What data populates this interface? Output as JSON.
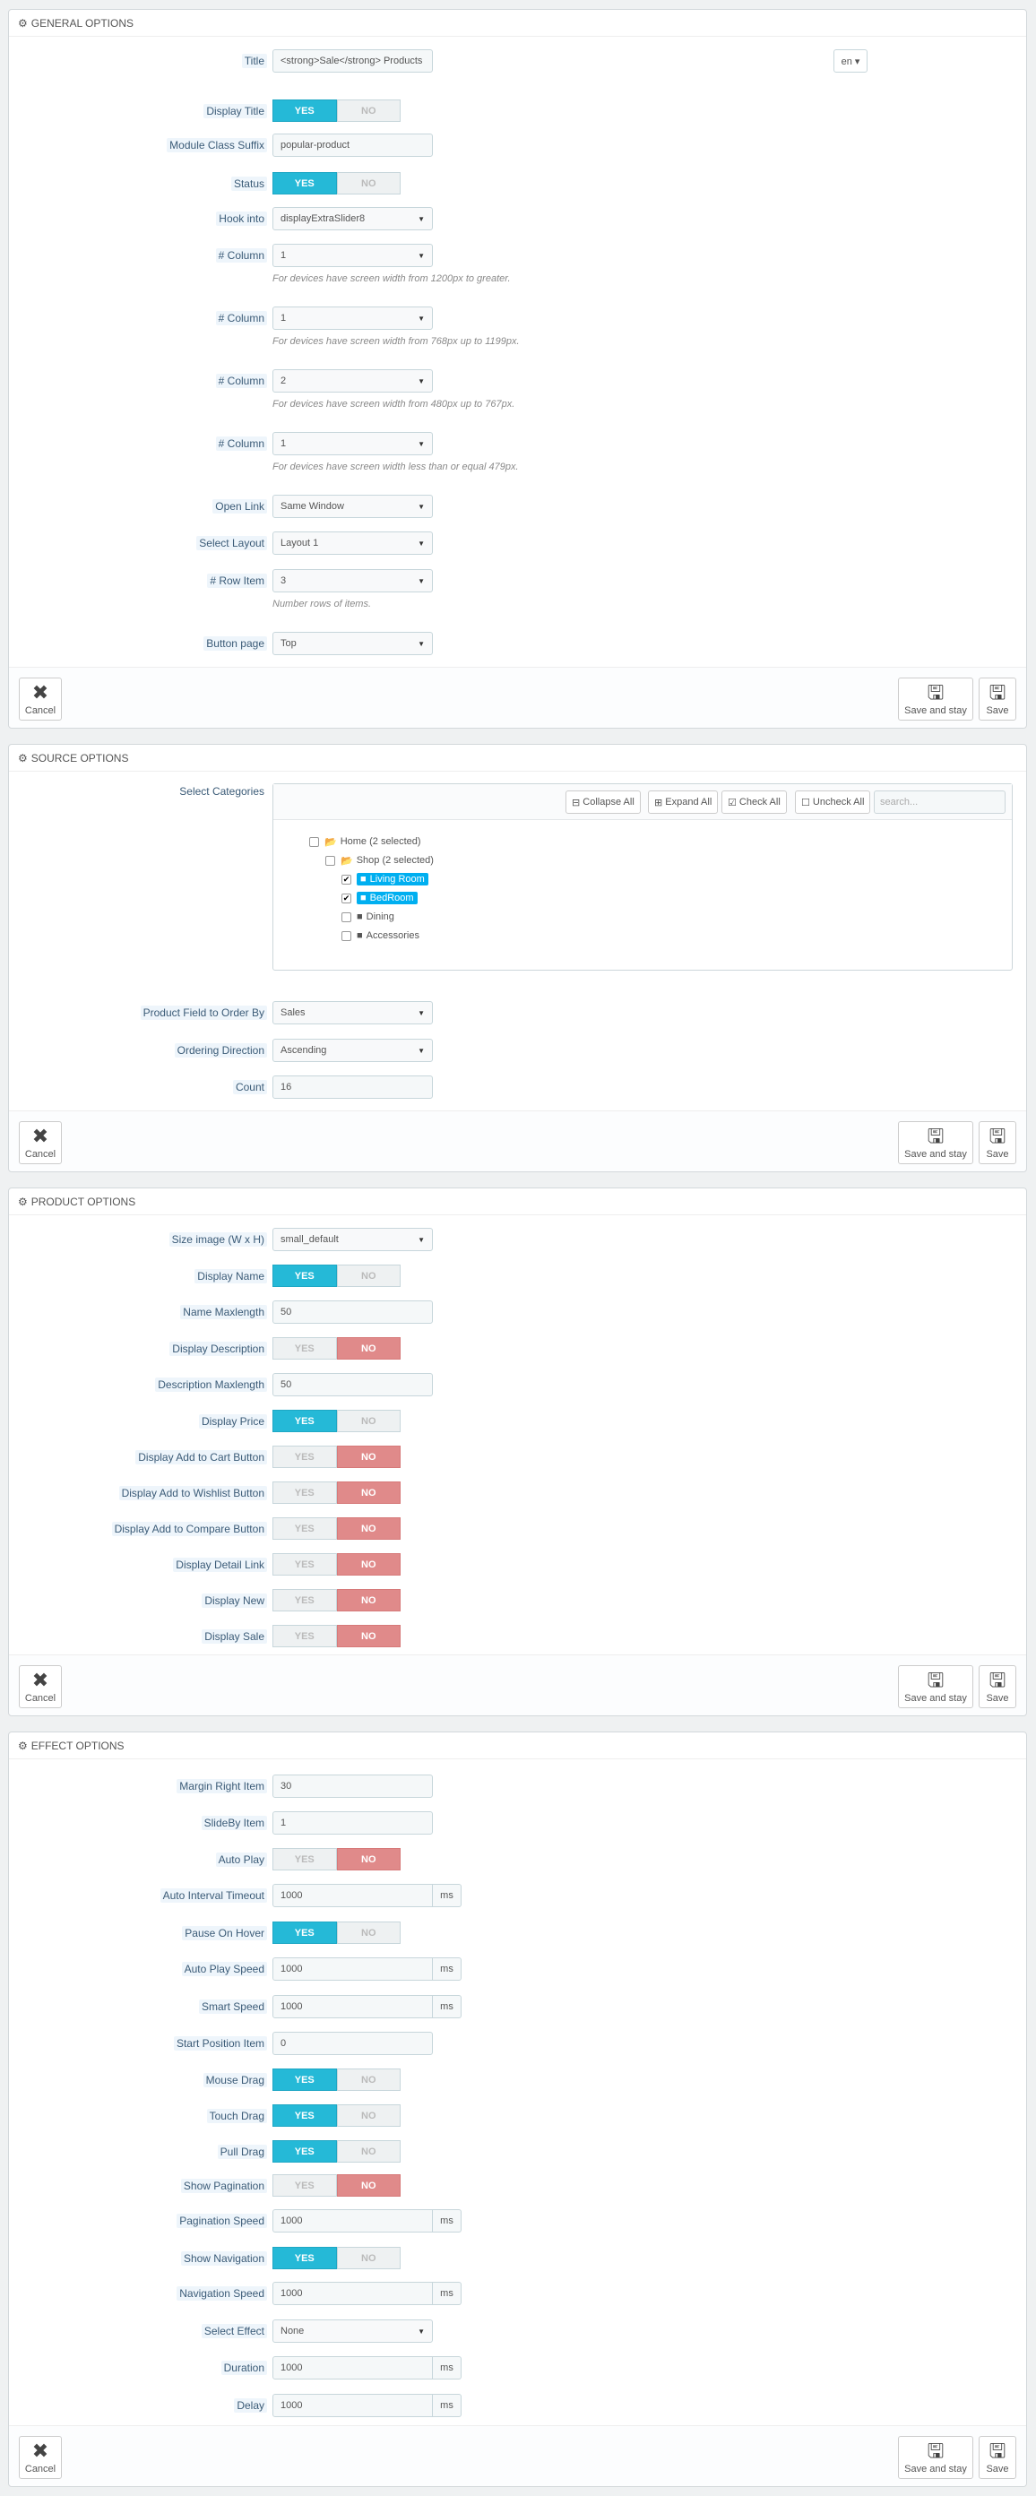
{
  "footer": {
    "cancel": "Cancel",
    "save_stay": "Save and stay",
    "save": "Save"
  },
  "toggle": {
    "yes": "YES",
    "no": "NO"
  },
  "general": {
    "heading": "GENERAL OPTIONS",
    "title_label": "Title",
    "title_value": "<strong>Sale</strong> Products",
    "lang": "en ▾",
    "display_title_label": "Display Title",
    "class_suffix_label": "Module Class Suffix",
    "class_suffix_value": "popular-product",
    "status_label": "Status",
    "hook_label": "Hook into",
    "hook_value": "displayExtraSlider8",
    "column_label": "# Column",
    "col1_value": "1",
    "col1_help": "For devices have screen width from 1200px to greater.",
    "col2_value": "1",
    "col2_help": "For devices have screen width from 768px up to 1199px.",
    "col3_value": "2",
    "col3_help": "For devices have screen width from 480px up to 767px.",
    "col4_value": "1",
    "col4_help": "For devices have screen width less than or equal 479px.",
    "open_link_label": "Open Link",
    "open_link_value": "Same Window",
    "layout_label": "Select Layout",
    "layout_value": "Layout 1",
    "row_item_label": "# Row Item",
    "row_item_value": "3",
    "row_item_help": "Number rows of items.",
    "button_page_label": "Button page",
    "button_page_value": "Top"
  },
  "source": {
    "heading": "SOURCE OPTIONS",
    "categories_label": "Select Categories",
    "collapse_all": "Collapse All",
    "expand_all": "Expand All",
    "check_all": "Check All",
    "uncheck_all": "Uncheck All",
    "search_placeholder": "search...",
    "tree": {
      "home": "Home (2 selected)",
      "shop": "Shop (2 selected)",
      "living": "Living Room",
      "bedroom": "BedRoom",
      "dining": "Dining",
      "accessories": "Accessories"
    },
    "order_by_label": "Product Field to Order By",
    "order_by_value": "Sales",
    "direction_label": "Ordering Direction",
    "direction_value": "Ascending",
    "count_label": "Count",
    "count_value": "16"
  },
  "product": {
    "heading": "PRODUCT OPTIONS",
    "size_label": "Size image (W x H)",
    "size_value": "small_default",
    "display_name_label": "Display Name",
    "name_max_label": "Name Maxlength",
    "name_max_value": "50",
    "display_desc_label": "Display Description",
    "desc_max_label": "Description Maxlength",
    "desc_max_value": "50",
    "display_price_label": "Display Price",
    "add_cart_label": "Display Add to Cart Button",
    "add_wishlist_label": "Display Add to Wishlist Button",
    "add_compare_label": "Display Add to Compare Button",
    "detail_link_label": "Display Detail Link",
    "display_new_label": "Display New",
    "display_sale_label": "Display Sale"
  },
  "effect": {
    "heading": "EFFECT OPTIONS",
    "ms": "ms",
    "margin_label": "Margin Right Item",
    "margin_value": "30",
    "slideby_label": "SlideBy Item",
    "slideby_value": "1",
    "autoplay_label": "Auto Play",
    "interval_label": "Auto Interval Timeout",
    "interval_value": "1000",
    "pause_label": "Pause On Hover",
    "autoplay_speed_label": "Auto Play Speed",
    "autoplay_speed_value": "1000",
    "smart_speed_label": "Smart Speed",
    "smart_speed_value": "1000",
    "start_pos_label": "Start Position Item",
    "start_pos_value": "0",
    "mouse_drag_label": "Mouse Drag",
    "touch_drag_label": "Touch Drag",
    "pull_drag_label": "Pull Drag",
    "show_pagination_label": "Show Pagination",
    "pagination_speed_label": "Pagination Speed",
    "pagination_speed_value": "1000",
    "show_navigation_label": "Show Navigation",
    "navigation_speed_label": "Navigation Speed",
    "navigation_speed_value": "1000",
    "select_effect_label": "Select Effect",
    "select_effect_value": "None",
    "duration_label": "Duration",
    "duration_value": "1000",
    "delay_label": "Delay",
    "delay_value": "1000"
  }
}
